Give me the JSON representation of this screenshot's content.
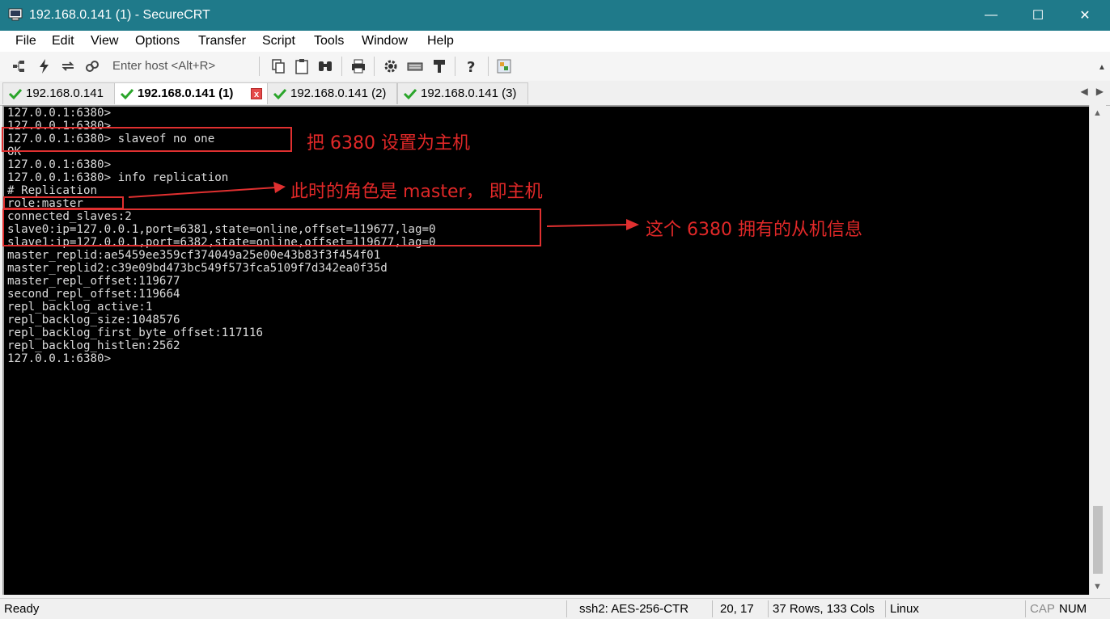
{
  "window": {
    "title": "192.168.0.141 (1) - SecureCRT",
    "minimize": "—",
    "maximize": "☐",
    "close": "✕"
  },
  "menu": [
    "File",
    "Edit",
    "View",
    "Options",
    "Transfer",
    "Script",
    "Tools",
    "Window",
    "Help"
  ],
  "toolbar": {
    "host_placeholder": "Enter host <Alt+R>",
    "icons": [
      "connect-icon",
      "quick-connect-icon",
      "reconnect-icon",
      "disconnect-icon",
      "copy-icon",
      "paste-icon",
      "find-icon",
      "print-icon",
      "settings-icon",
      "keymap-icon",
      "sftp-icon",
      "help-icon",
      "sessions-icon"
    ]
  },
  "tabs": [
    {
      "label": "192.168.0.141",
      "active": false
    },
    {
      "label": "192.168.0.141 (1)",
      "active": true,
      "close": "x"
    },
    {
      "label": "192.168.0.141 (2)",
      "active": false
    },
    {
      "label": "192.168.0.141 (3)",
      "active": false
    }
  ],
  "terminal": {
    "lines": [
      "127.0.0.1:6380>",
      "127.0.0.1:6380>",
      "127.0.0.1:6380> slaveof no one",
      "OK",
      "127.0.0.1:6380>",
      "127.0.0.1:6380> info replication",
      "# Replication",
      "role:master",
      "connected_slaves:2",
      "slave0:ip=127.0.0.1,port=6381,state=online,offset=119677,lag=0",
      "slave1:ip=127.0.0.1,port=6382,state=online,offset=119677,lag=0",
      "master_replid:ae5459ee359cf374049a25e00e43b83f3f454f01",
      "master_replid2:c39e09bd473bc549f573fca5109f7d342ea0f35d",
      "master_repl_offset:119677",
      "second_repl_offset:119664",
      "repl_backlog_active:1",
      "repl_backlog_size:1048576",
      "repl_backlog_first_byte_offset:117116",
      "repl_backlog_histlen:2562",
      "127.0.0.1:6380>"
    ]
  },
  "annotations": {
    "note1": "把 6380 设置为主机",
    "note2": "此时的角色是 master， 即主机",
    "note3": "这个 6380 拥有的从机信息",
    "color": "#e02828"
  },
  "status": {
    "ready": "Ready",
    "cipher": "ssh2: AES-256-CTR",
    "cursor": "20,  17",
    "size": "37 Rows, 133 Cols",
    "os": "Linux",
    "cap": "CAP",
    "num": "NUM"
  },
  "colors": {
    "titlebar": "#1f7a8a",
    "terminal_bg": "#000000",
    "terminal_fg": "#dcdcdc",
    "tab_check": "#2aa52a"
  }
}
